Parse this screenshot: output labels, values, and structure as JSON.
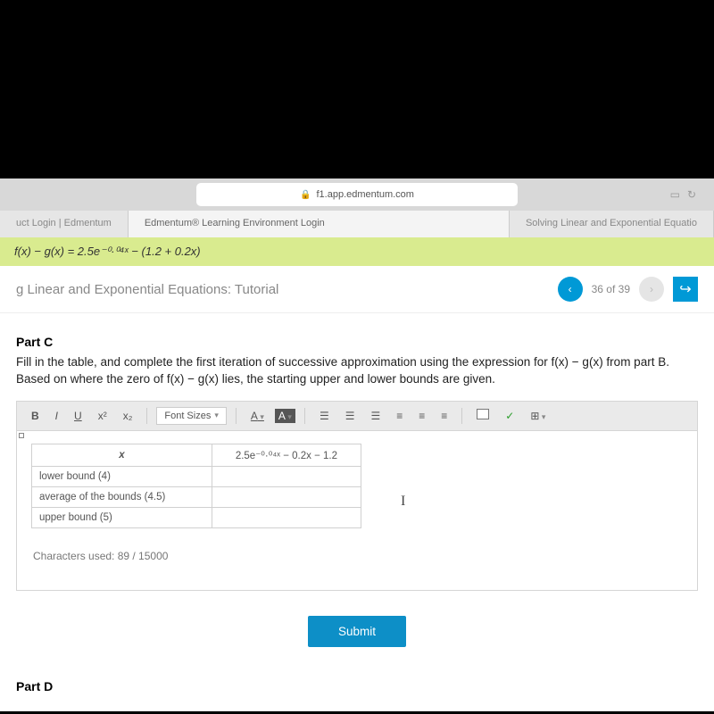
{
  "browser": {
    "url": "f1.app.edmentum.com",
    "reload": "↻",
    "book": "▭"
  },
  "tabs": {
    "left": "uct Login | Edmentum",
    "center": "Edmentum® Learning Environment Login",
    "right": "Solving Linear and Exponential Equatio"
  },
  "equation": "f(x) − g(x) = 2.5e⁻⁰·⁰⁴ˣ − (1.2 + 0.2x)",
  "tutorial": {
    "title": "g Linear and Exponential Equations: Tutorial",
    "pager_text": "36 of 39",
    "prev": "‹",
    "next": "›",
    "exit": "↪"
  },
  "partC": {
    "label": "Part C",
    "instructions": "Fill in the table, and complete the first iteration of successive approximation using the expression for f(x) − g(x) from part B. Based on where the zero of f(x) − g(x) lies, the starting upper and lower bounds are given."
  },
  "toolbar": {
    "bold": "B",
    "italic": "I",
    "underline": "U",
    "sup": "x²",
    "sub": "x₂",
    "fontsizes": "Font Sizes",
    "A1": "A",
    "A2": "A",
    "check": "✓"
  },
  "table": {
    "head_x": "x",
    "head_expr": "2.5e⁻⁰·⁰⁴ˣ − 0.2x − 1.2",
    "row1": "lower bound (4)",
    "row2": "average of the bounds (4.5)",
    "row3": "upper bound (5)"
  },
  "chars": "Characters used: 89 / 15000",
  "submit": "Submit",
  "partD": "Part D"
}
